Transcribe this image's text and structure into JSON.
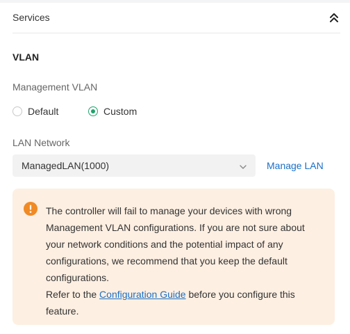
{
  "header": {
    "title": "Services"
  },
  "vlan": {
    "section_title": "VLAN",
    "management_label": "Management VLAN",
    "options": [
      {
        "label": "Default",
        "selected": false
      },
      {
        "label": "Custom",
        "selected": true
      }
    ]
  },
  "lan": {
    "label": "LAN Network",
    "selected_value": "ManagedLAN(1000)",
    "manage_link": "Manage LAN"
  },
  "alert": {
    "message": "The controller will fail to manage your devices with wrong Management VLAN configurations. If you are not sure about your network conditions and the potential impact of any configurations, we recommend that you keep the default configurations.",
    "refer_prefix": "Refer to the ",
    "guide_link": "Configuration Guide",
    "refer_suffix": " before you configure this feature."
  },
  "colors": {
    "accent_green": "#1fa26b",
    "link_blue": "#1a6fc7",
    "warning_orange": "#f08a24",
    "alert_background": "#fdefe2"
  },
  "icons": {
    "collapse": "double-chevron-up-icon",
    "dropdown": "chevron-down-icon",
    "warning": "warning-circle-icon"
  }
}
